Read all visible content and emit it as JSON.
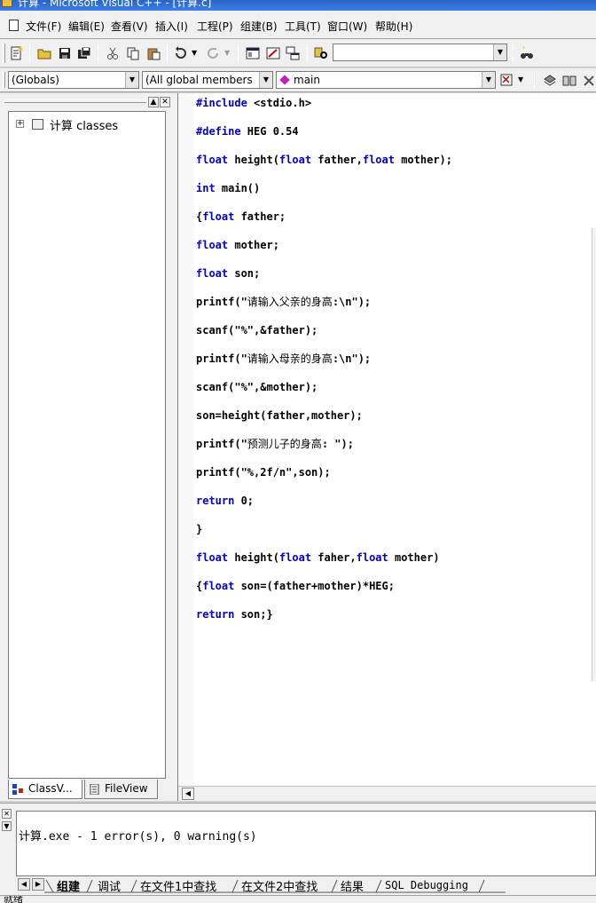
{
  "window": {
    "title": "计算 - Microsoft Visual C++ - [计算.c]"
  },
  "menu": [
    "文件(F)",
    "编辑(E)",
    "查看(V)",
    "插入(I)",
    "工程(P)",
    "组建(B)",
    "工具(T)",
    "窗口(W)",
    "帮助(H)"
  ],
  "toolbar": {
    "find_combo_value": ""
  },
  "wizardbar": {
    "scope": "(Globals)",
    "members": "(All global members",
    "function": "main"
  },
  "classview": {
    "tree_root": "计算 classes",
    "tabs": [
      "ClassV...",
      "FileView"
    ]
  },
  "code": [
    "#include <stdio.h>",
    "#define HEG 0.54",
    "float height(float father,float mother);",
    "int main()",
    "{float father;",
    "float mother;",
    "float son;",
    "printf(\"请输入父亲的身高:\\n\");",
    "scanf(\"%\",&father);",
    "printf(\"请输入母亲的身高:\\n\");",
    "scanf(\"%\",&mother);",
    "son=height(father,mother);",
    "printf(\"预测儿子的身高: \");",
    "printf(\"%,2f/n\",son);",
    "return 0;",
    "}",
    "float height(float faher,float mother)",
    "{float son=(father+mother)*HEG;",
    "return son;}"
  ],
  "output": {
    "message": "计算.exe - 1 error(s), 0 warning(s)",
    "tabs": [
      "组建",
      "调试",
      "在文件1中查找",
      "在文件2中查找",
      "结果",
      "SQL Debugging"
    ]
  },
  "statusbar": {
    "text": "就绪"
  },
  "colors": {
    "keyword": "#0000cc",
    "titlebar": "#2a65c8"
  }
}
